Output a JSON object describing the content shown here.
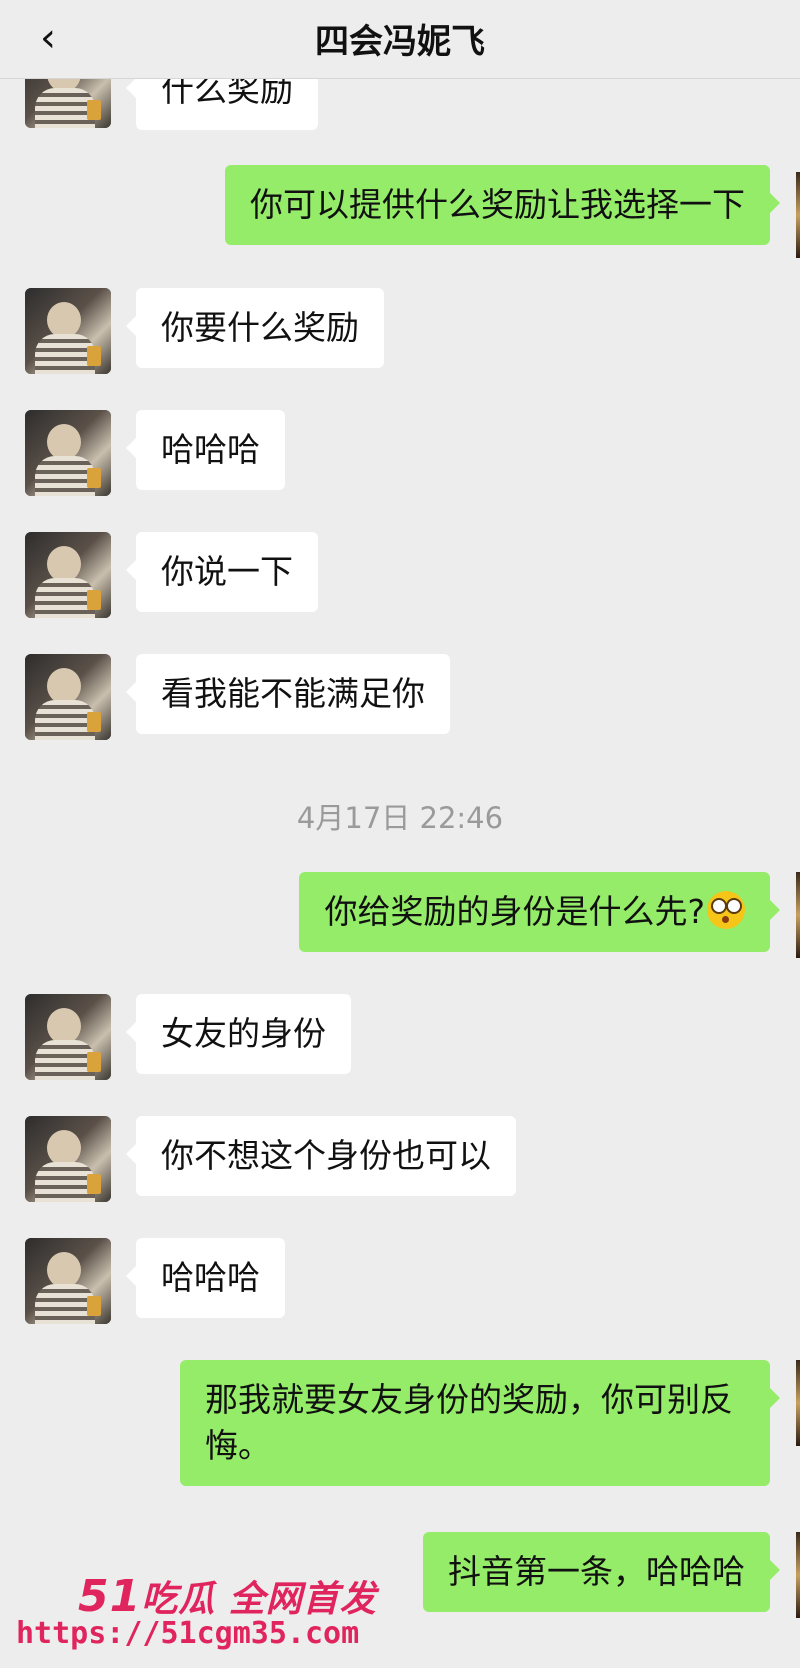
{
  "header": {
    "back_icon": "chevron-left-icon",
    "title": "四会冯妮飞"
  },
  "messages": [
    {
      "side": "left",
      "text": "什么奖励"
    },
    {
      "side": "right",
      "text": "你可以提供什么奖励让我选择一下"
    },
    {
      "side": "left",
      "text": "你要什么奖励"
    },
    {
      "side": "left",
      "text": "哈哈哈"
    },
    {
      "side": "left",
      "text": "你说一下"
    },
    {
      "side": "left",
      "text": "看我能不能满足你"
    },
    {
      "side": "right",
      "text": "你给奖励的身份是什么先?",
      "emoji": "flushed-face-icon"
    },
    {
      "side": "left",
      "text": "女友的身份"
    },
    {
      "side": "left",
      "text": "你不想这个身份也可以"
    },
    {
      "side": "left",
      "text": "哈哈哈"
    },
    {
      "side": "right",
      "text": "那我就要女友身份的奖励，你可别反悔。"
    },
    {
      "side": "right",
      "text": "抖音第一条，哈哈哈"
    }
  ],
  "timestamp": "4月17日 22:46",
  "watermark": {
    "brand_number": "51",
    "brand_text": "吃瓜 全网首发",
    "url": "https://51cgm35.com"
  },
  "colors": {
    "background": "#ededed",
    "incoming_bubble": "#ffffff",
    "outgoing_bubble": "#95ec69",
    "watermark": "#e0245e"
  }
}
